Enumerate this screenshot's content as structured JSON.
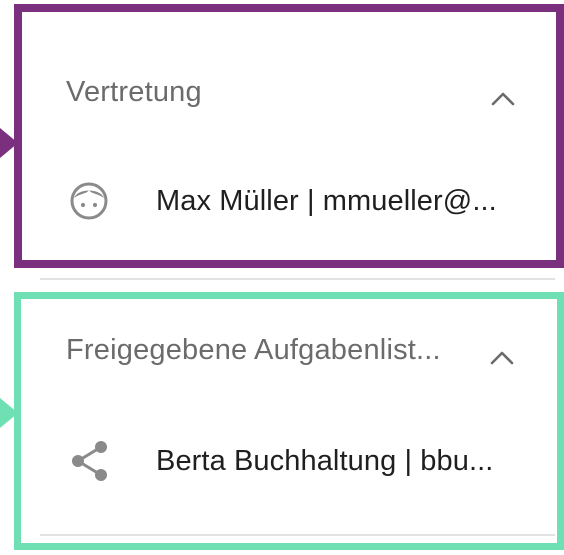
{
  "colors": {
    "highlight_primary": "#7b2f7f",
    "highlight_secondary": "#6fe0b4",
    "header_text": "#6b6b6b",
    "body_text": "#1f1f1f",
    "icon": "#8a8a8a"
  },
  "sections": [
    {
      "title": "Vertretung",
      "chevron_icon": "chevron-up-icon",
      "item": {
        "icon": "face-icon",
        "label": "Max Müller | mmueller@..."
      }
    },
    {
      "title": "Freigegebene Aufgabenlist...",
      "chevron_icon": "chevron-up-icon",
      "item": {
        "icon": "share-icon",
        "label": "Berta Buchhaltung | bbu..."
      }
    }
  ]
}
